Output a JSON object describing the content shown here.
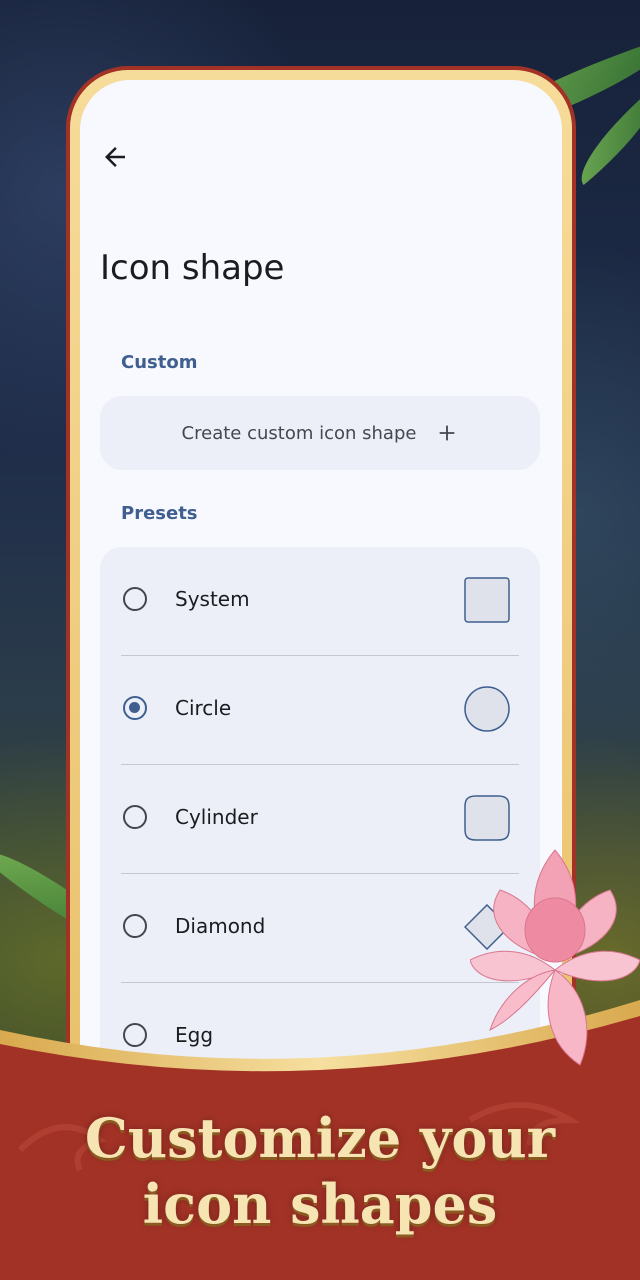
{
  "screen": {
    "title": "Icon shape",
    "custom_section": "Custom",
    "custom_button_label": "Create custom icon shape",
    "presets_section": "Presets",
    "presets": [
      {
        "label": "System",
        "shape": "square",
        "selected": false
      },
      {
        "label": "Circle",
        "shape": "circle",
        "selected": true
      },
      {
        "label": "Cylinder",
        "shape": "cylinder",
        "selected": false
      },
      {
        "label": "Diamond",
        "shape": "diamond",
        "selected": false
      },
      {
        "label": "Egg",
        "shape": "egg",
        "selected": false
      }
    ]
  },
  "promo": {
    "line1": "Customize your",
    "line2": "icon shapes"
  },
  "colors": {
    "accent": "#3f5f8f",
    "banner": "#a33226",
    "gold": "#f0cf84"
  }
}
